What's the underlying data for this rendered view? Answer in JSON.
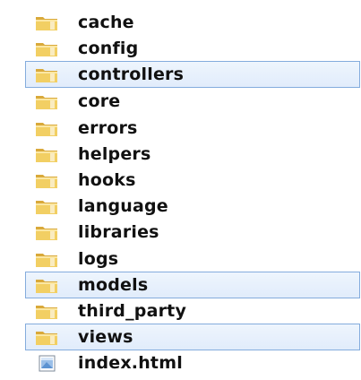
{
  "items": [
    {
      "label": "cache",
      "type": "folder",
      "icon": "folder-icon",
      "selected": false
    },
    {
      "label": "config",
      "type": "folder",
      "icon": "folder-icon",
      "selected": false
    },
    {
      "label": "controllers",
      "type": "folder",
      "icon": "folder-icon",
      "selected": true
    },
    {
      "label": "core",
      "type": "folder",
      "icon": "folder-icon",
      "selected": false
    },
    {
      "label": "errors",
      "type": "folder",
      "icon": "folder-icon",
      "selected": false
    },
    {
      "label": "helpers",
      "type": "folder",
      "icon": "folder-icon",
      "selected": false
    },
    {
      "label": "hooks",
      "type": "folder",
      "icon": "folder-icon",
      "selected": false
    },
    {
      "label": "language",
      "type": "folder",
      "icon": "folder-icon",
      "selected": false
    },
    {
      "label": "libraries",
      "type": "folder",
      "icon": "folder-icon",
      "selected": false
    },
    {
      "label": "logs",
      "type": "folder",
      "icon": "folder-icon",
      "selected": false
    },
    {
      "label": "models",
      "type": "folder",
      "icon": "folder-icon",
      "selected": true
    },
    {
      "label": "third_party",
      "type": "folder",
      "icon": "folder-icon",
      "selected": false
    },
    {
      "label": "views",
      "type": "folder",
      "icon": "folder-icon",
      "selected": true
    },
    {
      "label": "index.html",
      "type": "file",
      "icon": "html-file-icon",
      "selected": false
    }
  ],
  "colors": {
    "selection_fill": "#e4eefb",
    "selection_border": "#84acdd",
    "folder_body": "#f2cf63",
    "folder_tab": "#d9a93a"
  }
}
